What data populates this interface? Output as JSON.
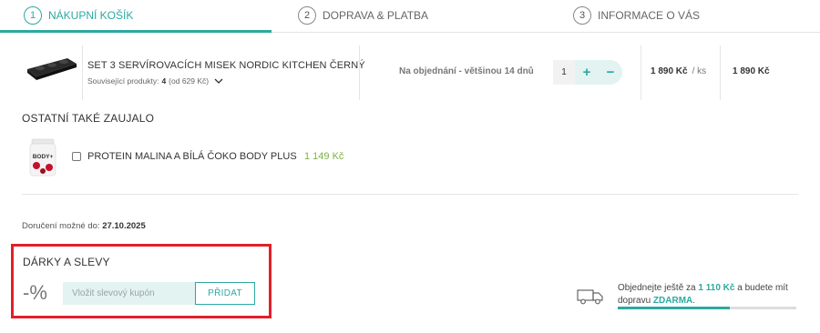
{
  "steps": [
    {
      "num": "1",
      "label": "NÁKUPNÍ KOŠÍK",
      "active": true
    },
    {
      "num": "2",
      "label": "DOPRAVA & PLATBA",
      "active": false
    },
    {
      "num": "3",
      "label": "INFORMACE O VÁS",
      "active": false
    }
  ],
  "cart": {
    "product_name": "SET 3 SERVÍROVACÍCH MISEK NORDIC KITCHEN ČERNÝ",
    "related_label": "Související produkty:",
    "related_count": "4",
    "related_from": "(od 629 Kč)",
    "availability": "Na objednání - většinou 14 dnů",
    "quantity": "1",
    "plus": "+",
    "minus": "−",
    "unit_price": "1 890 Kč",
    "unit_suffix": "/ ks",
    "total_price": "1 890 Kč"
  },
  "also": {
    "title": "OSTATNÍ TAKÉ ZAUJALO",
    "product_name": "PROTEIN MALINA A BÍLÁ ČOKO BODY PLUS",
    "price": "1 149 Kč",
    "image_text": "BODY+"
  },
  "delivery": {
    "label": "Doručení možné do:",
    "date": "27.10.2025"
  },
  "gifts": {
    "title": "DÁRKY A SLEVY",
    "percent_icon": "-%",
    "coupon_placeholder": "Vložit slevový kupón",
    "add_label": "PŘIDAT"
  },
  "shipping": {
    "text_pre": "Objednejte ještě za",
    "amount": "1 110 Kč",
    "text_mid": "a budete mít dopravu",
    "free": "ZDARMA",
    "text_end": ".",
    "progress": 0.63
  },
  "colors": {
    "accent": "#2ca9a0",
    "price_green": "#7cb342",
    "highlight_red": "#e0202b",
    "accent_light": "#e2f3f2"
  },
  "icons": {
    "chevron": "chevron-down-icon",
    "truck": "truck-icon"
  }
}
